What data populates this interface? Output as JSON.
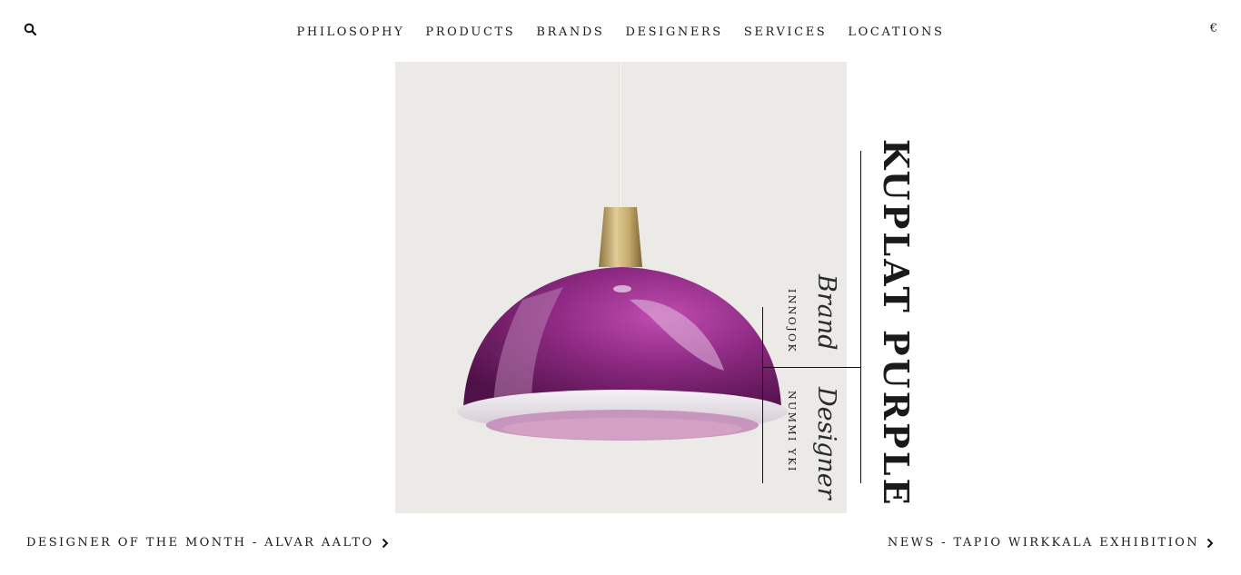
{
  "header": {
    "search_icon": "search-icon",
    "currency": "€",
    "nav": [
      {
        "label": "PHILOSOPHY"
      },
      {
        "label": "PRODUCTS"
      },
      {
        "label": "BRANDS"
      },
      {
        "label": "DESIGNERS"
      },
      {
        "label": "SERVICES"
      },
      {
        "label": "LOCATIONS"
      }
    ]
  },
  "product": {
    "title": "KUPLAT PURPLE",
    "brand_label": "Brand",
    "brand_name": "INNOJOK",
    "designer_label": "Designer",
    "designer_name": "NUMMI YKI",
    "image_subject": "purple pendant lamp with brass top",
    "colors": {
      "shade": "#7a1f6e",
      "shade_highlight": "#c04db0",
      "rim": "#e7e2ea",
      "inner": "#c795bd",
      "brass": "#c4a96b",
      "background": "#ebeae7"
    }
  },
  "footer": {
    "left_link": "DESIGNER OF THE MONTH - ALVAR AALTO",
    "right_link": "NEWS - TAPIO WIRKKALA EXHIBITION",
    "chevron_icon": "chevron-right-icon"
  }
}
